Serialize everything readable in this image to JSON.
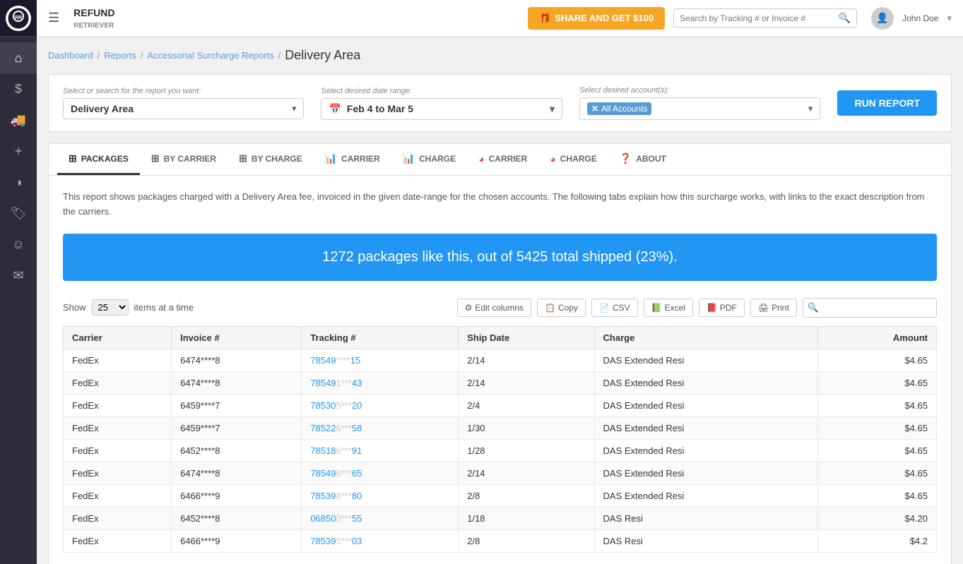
{
  "app": {
    "name": "Refund Retriever",
    "share_btn": "SHARE AND GET $100",
    "search_placeholder": "Search by Tracking # or Invoice #",
    "user_name": "John Doe"
  },
  "sidebar": {
    "items": [
      {
        "id": "home",
        "icon": "⌂",
        "label": "Home"
      },
      {
        "id": "dollar",
        "icon": "$",
        "label": "Savings"
      },
      {
        "id": "truck",
        "icon": "🚚",
        "label": "Shipments"
      },
      {
        "id": "plus",
        "icon": "+",
        "label": "Add"
      },
      {
        "id": "chart",
        "icon": "◑",
        "label": "Reports"
      },
      {
        "id": "tag",
        "icon": "🏷",
        "label": "Tags"
      },
      {
        "id": "smile",
        "icon": "☺",
        "label": "Profile"
      },
      {
        "id": "email",
        "icon": "✉",
        "label": "Messages"
      }
    ]
  },
  "breadcrumb": {
    "items": [
      "Dashboard",
      "Reports",
      "Accessorial Surcharge Reports"
    ],
    "current": "Delivery Area"
  },
  "filters": {
    "report_label": "Select or search for the report you want:",
    "report_value": "Delivery Area",
    "date_label": "Select desired date range:",
    "date_value": "Feb 4 to Mar 5",
    "account_label": "Select desired account(s):",
    "account_value": "All Accounts",
    "run_btn": "RUN REPORT"
  },
  "tabs": [
    {
      "id": "packages",
      "icon": "table",
      "label": "PACKAGES",
      "active": true
    },
    {
      "id": "by-carrier",
      "icon": "table",
      "label": "BY CARRIER",
      "active": false
    },
    {
      "id": "by-charge",
      "icon": "table",
      "label": "BY CHARGE",
      "active": false
    },
    {
      "id": "carrier-bar",
      "icon": "bar",
      "label": "CARRIER",
      "active": false
    },
    {
      "id": "charge-bar",
      "icon": "bar",
      "label": "CHARGE",
      "active": false
    },
    {
      "id": "carrier-pie",
      "icon": "pie",
      "label": "CARRIER",
      "active": false
    },
    {
      "id": "charge-pie",
      "icon": "pie",
      "label": "CHARGE",
      "active": false
    },
    {
      "id": "about",
      "icon": "question",
      "label": "ABOUT",
      "active": false
    }
  ],
  "report": {
    "info_text": "This report shows packages charged with a Delivery Area fee, invoiced in the given date-range for the chosen accounts. The following tabs explain how this surcharge works, with links to the exact description from the carriers.",
    "stats_text": "1272 packages like this, out of 5425 total shipped (23%)."
  },
  "table_controls": {
    "show_label": "Show",
    "show_value": "25",
    "items_label": "items at a time",
    "edit_columns": "Edit columns",
    "copy": "Copy",
    "csv": "CSV",
    "excel": "Excel",
    "pdf": "PDF",
    "print": "Print"
  },
  "table": {
    "columns": [
      "Carrier",
      "Invoice #",
      "Tracking #",
      "Ship Date",
      "Charge",
      "Amount"
    ],
    "rows": [
      {
        "carrier": "FedEx",
        "invoice": "6474****8",
        "tracking_prefix": "78549",
        "tracking_mid": "****",
        "tracking_suffix": "15",
        "ship_date": "2/14",
        "charge": "DAS Extended Resi",
        "amount": "$4.65"
      },
      {
        "carrier": "FedEx",
        "invoice": "6474****8",
        "tracking_prefix": "78549",
        "tracking_mid": "1***",
        "tracking_suffix": "43",
        "ship_date": "2/14",
        "charge": "DAS Extended Resi",
        "amount": "$4.65"
      },
      {
        "carrier": "FedEx",
        "invoice": "6459****7",
        "tracking_prefix": "78530",
        "tracking_mid": "5***",
        "tracking_suffix": "20",
        "ship_date": "2/4",
        "charge": "DAS Extended Resi",
        "amount": "$4.65"
      },
      {
        "carrier": "FedEx",
        "invoice": "6459****7",
        "tracking_prefix": "78522",
        "tracking_mid": "6***",
        "tracking_suffix": "58",
        "ship_date": "1/30",
        "charge": "DAS Extended Resi",
        "amount": "$4.65"
      },
      {
        "carrier": "FedEx",
        "invoice": "6452****8",
        "tracking_prefix": "78518",
        "tracking_mid": "6***",
        "tracking_suffix": "91",
        "ship_date": "1/28",
        "charge": "DAS Extended Resi",
        "amount": "$4.65"
      },
      {
        "carrier": "FedEx",
        "invoice": "6474****8",
        "tracking_prefix": "78549",
        "tracking_mid": "6***",
        "tracking_suffix": "65",
        "ship_date": "2/14",
        "charge": "DAS Extended Resi",
        "amount": "$4.65"
      },
      {
        "carrier": "FedEx",
        "invoice": "6466****9",
        "tracking_prefix": "78539",
        "tracking_mid": "8***",
        "tracking_suffix": "80",
        "ship_date": "2/8",
        "charge": "DAS Extended Resi",
        "amount": "$4.65"
      },
      {
        "carrier": "FedEx",
        "invoice": "6452****8",
        "tracking_prefix": "06850",
        "tracking_mid": "0***",
        "tracking_suffix": "55",
        "ship_date": "1/18",
        "charge": "DAS Resi",
        "amount": "$4.20"
      },
      {
        "carrier": "FedEx",
        "invoice": "6466****9",
        "tracking_prefix": "78539",
        "tracking_mid": "5***",
        "tracking_suffix": "03",
        "ship_date": "2/8",
        "charge": "DAS Resi",
        "amount": "$4.2"
      }
    ]
  }
}
